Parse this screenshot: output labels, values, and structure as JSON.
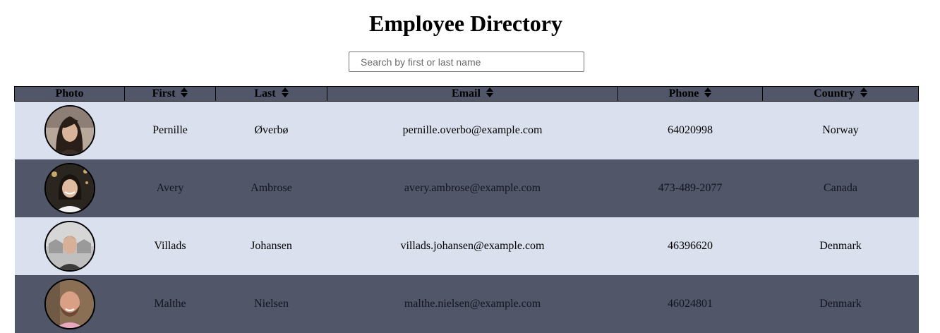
{
  "page": {
    "title": "Employee Directory"
  },
  "search": {
    "placeholder": "Search by first or last name",
    "value": ""
  },
  "table": {
    "columns": [
      {
        "label": "Photo",
        "sortable": false
      },
      {
        "label": "First",
        "sortable": true
      },
      {
        "label": "Last",
        "sortable": true
      },
      {
        "label": "Email",
        "sortable": true
      },
      {
        "label": "Phone",
        "sortable": true
      },
      {
        "label": "Country",
        "sortable": true
      }
    ],
    "rows": [
      {
        "first": "Pernille",
        "last": "Øverbø",
        "email": "pernille.overbo@example.com",
        "phone": "64020998",
        "country": "Norway"
      },
      {
        "first": "Avery",
        "last": "Ambrose",
        "email": "avery.ambrose@example.com",
        "phone": "473-489-2077",
        "country": "Canada"
      },
      {
        "first": "Villads",
        "last": "Johansen",
        "email": "villads.johansen@example.com",
        "phone": "46396620",
        "country": "Denmark"
      },
      {
        "first": "Malthe",
        "last": "Nielsen",
        "email": "malthe.nielsen@example.com",
        "phone": "46024801",
        "country": "Denmark"
      }
    ]
  },
  "colors": {
    "header_bg": "#515668",
    "row_light": "#dbe0ee",
    "row_dark": "#515668"
  },
  "icons": {
    "sort": "sort-icon"
  }
}
